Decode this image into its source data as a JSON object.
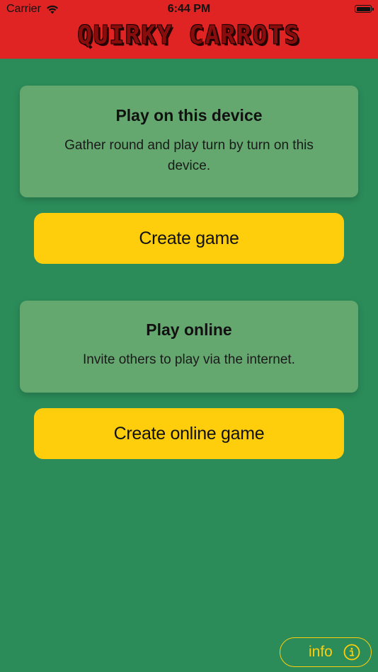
{
  "status_bar": {
    "carrier": "Carrier",
    "time": "6:44 PM",
    "icons": [
      "wifi-icon",
      "battery-icon"
    ]
  },
  "header": {
    "title": "QUIRKY CARROTS",
    "background_color": "#e02424",
    "title_color": "#8a0d0d"
  },
  "local_section": {
    "heading": "Play on this device",
    "description": "Gather round and play turn by turn on this device.",
    "button_label": "Create game"
  },
  "online_section": {
    "heading": "Play online",
    "description": "Invite others to play via the internet.",
    "button_label": "Create online game"
  },
  "info_button": {
    "label": "info",
    "icon": "info-circle-icon"
  },
  "colors": {
    "background": "#2b8c59",
    "card": "#64a86f",
    "accent": "#fecd0b"
  }
}
